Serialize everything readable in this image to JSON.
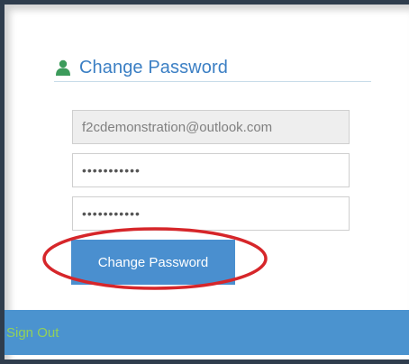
{
  "panel": {
    "title": "Change Password",
    "icon": "user-icon"
  },
  "form": {
    "email_value": "f2cdemonstration@outlook.com",
    "password_value": "•••••••••••",
    "confirm_password_value": "•••••••••••",
    "submit_label": "Change Password"
  },
  "footer": {
    "sign_out_label": "Sign Out"
  },
  "colors": {
    "accent": "#4a8fcf",
    "title": "#3b7fc4",
    "icon_green": "#3c9b5b",
    "sign_out": "#92d05a",
    "frame": "#2f3d4d",
    "annotation_red": "#d6262a"
  }
}
